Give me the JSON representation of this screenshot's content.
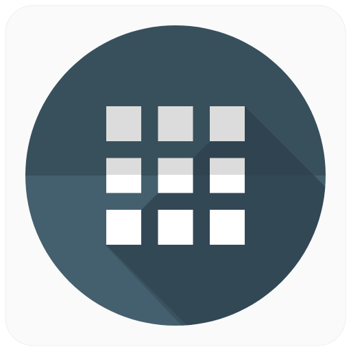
{
  "icon": {
    "name": "apps-grid-launcher-icon",
    "shape": "circle",
    "grid": {
      "rows": 3,
      "columns": 3
    },
    "colors": {
      "page_background": "#ffffff",
      "tile_background": "#fafafa",
      "circle_upper": "#38505c",
      "circle_lower": "#44606f",
      "long_shadow": "#2b3e48",
      "square_upper": "#dcdcdc",
      "square_lower": "#ffffff"
    }
  }
}
